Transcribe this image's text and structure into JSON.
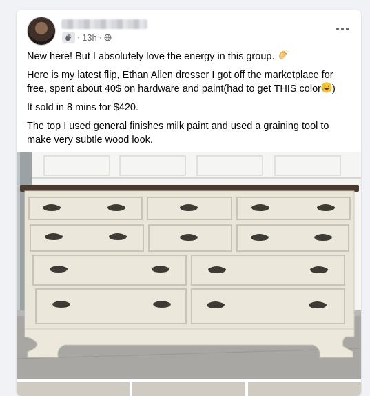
{
  "post": {
    "time": "13h",
    "separator": "·",
    "icons": {
      "badge": "new-member-wave-icon",
      "audience": "globe-icon",
      "menu": "more-options-icon"
    },
    "paragraphs": {
      "p1": "New here! But I absolutely love the energy in this group.",
      "p2": "Here is my latest flip, Ethan Allen dresser I got off the marketplace for free, spent about 40$ on hardware and paint(had to get THIS color",
      "p2_end": ")",
      "p3": "It sold in 8 mins for $420.",
      "p4": "The top I used general finishes milk paint and used a graining tool to make very subtle wood look."
    },
    "emojis": {
      "clap": "clapping-hands-emoji",
      "laugh": "tongue-out-wink-emoji"
    }
  },
  "photo": {
    "subject": "white-painted-dresser-photo",
    "colors": {
      "dresser": "#e9e5d8",
      "top": "#4a3b2f",
      "pulls": "#3e3a34",
      "garage": "#f4f4f2"
    }
  }
}
